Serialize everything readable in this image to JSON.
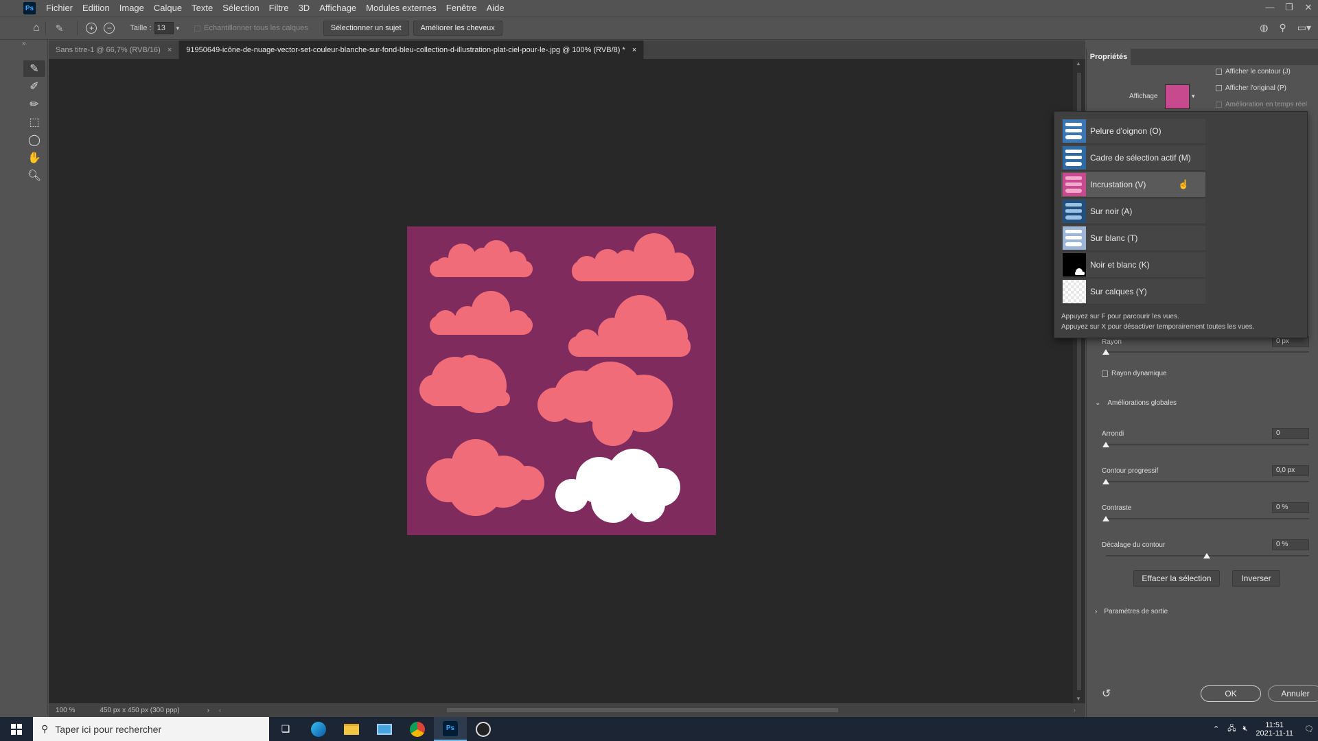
{
  "menubar": {
    "logo": "Ps",
    "items": [
      "Fichier",
      "Edition",
      "Image",
      "Calque",
      "Texte",
      "Sélection",
      "Filtre",
      "3D",
      "Affichage",
      "Modules externes",
      "Fenêtre",
      "Aide"
    ]
  },
  "options": {
    "size_label": "Taille :",
    "size_value": "13",
    "sample_all_label": "Echantillonner tous les calques",
    "select_subject": "Sélectionner un sujet",
    "refine_hair": "Améliorer les cheveux"
  },
  "tabs": [
    {
      "label": "Sans titre-1 @ 66,7% (RVB/16)",
      "close": "×"
    },
    {
      "label": "91950649-icône-de-nuage-vector-set-couleur-blanche-sur-fond-bleu-collection-d-illustration-plat-ciel-pour-le-.jpg @ 100% (RVB/8) *",
      "close": "×"
    }
  ],
  "status": {
    "zoom": "100 %",
    "doc_info": "450 px x 450 px (300 ppp)"
  },
  "colors": {
    "artwork_bg": "#7f2b5e",
    "cloud": "#f06c78",
    "cloud_selected": "#ffffff",
    "overlay": "#d8559b"
  },
  "properties": {
    "tab": "Propriétés",
    "view_label": "Affichage",
    "show_edge": "Afficher le contour (J)",
    "show_original": "Afficher l'original (P)",
    "realtime": "Amélioration en temps réel",
    "radius_label": "Rayon",
    "radius_value": "0 px",
    "smart_radius": "Rayon dynamique",
    "global_section": "Améliorations globales",
    "smooth_label": "Arrondi",
    "smooth_value": "0",
    "feather_label": "Contour progressif",
    "feather_value": "0,0 px",
    "contrast_label": "Contraste",
    "contrast_value": "0 %",
    "shift_label": "Décalage du contour",
    "shift_value": "0 %",
    "clear_btn": "Effacer la sélection",
    "invert_btn": "Inverser",
    "output_section": "Paramètres de sortie",
    "ok": "OK",
    "cancel": "Annuler"
  },
  "dropdown": {
    "items": [
      {
        "label": "Pelure d'oignon (O)",
        "icon": "onion-skin-thumb"
      },
      {
        "label": "Cadre de sélection actif (M)",
        "icon": "marching-ants-thumb"
      },
      {
        "label": "Incrustation (V)",
        "icon": "overlay-thumb"
      },
      {
        "label": "Sur noir (A)",
        "icon": "on-black-thumb"
      },
      {
        "label": "Sur blanc (T)",
        "icon": "on-white-thumb"
      },
      {
        "label": "Noir et blanc (K)",
        "icon": "black-white-thumb"
      },
      {
        "label": "Sur calques (Y)",
        "icon": "on-layers-thumb"
      }
    ],
    "hint1": "Appuyez sur F pour parcourir les vues.",
    "hint2": "Appuyez sur X pour désactiver temporairement toutes les vues."
  },
  "taskbar": {
    "search_placeholder": "Taper ici pour rechercher",
    "time": "11:51",
    "date": "2021-11-11"
  }
}
